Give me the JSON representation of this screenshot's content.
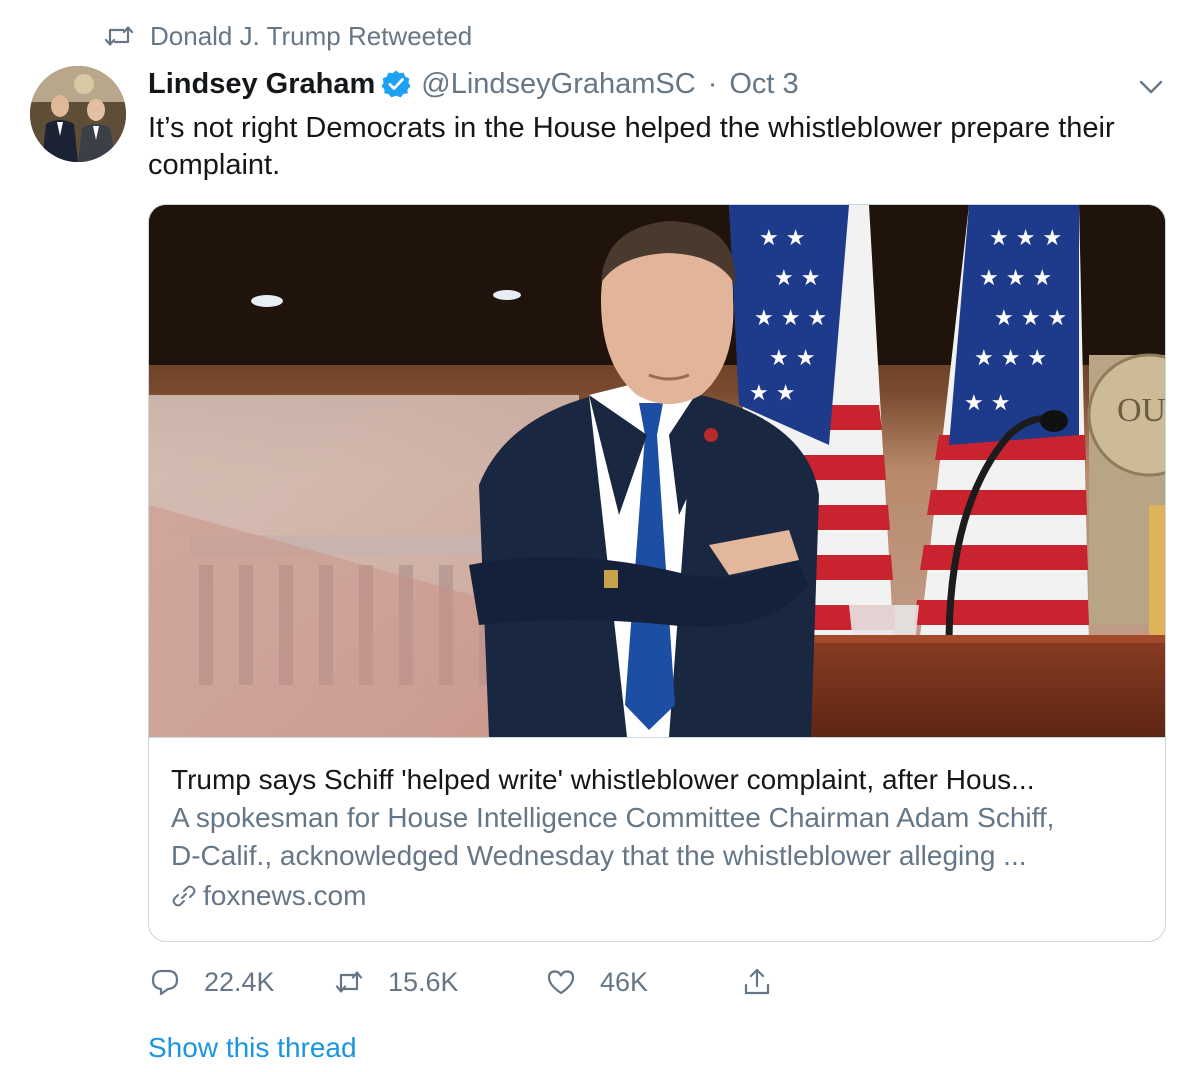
{
  "retweet_banner": {
    "text": "Donald J. Trump Retweeted",
    "icon": "retweet-icon"
  },
  "author": {
    "display_name": "Lindsey Graham",
    "verified": true,
    "handle": "@LindseyGrahamSC",
    "separator": "·",
    "date": "Oct 3"
  },
  "tweet": {
    "text": "It’s not right Democrats in the House helped the whistleblower prepare their complaint."
  },
  "card": {
    "title": "Trump says Schiff 'helped write' whistleblower complaint, after Hous...",
    "description_line1": "A spokesman for House Intelligence Committee Chairman Adam Schiff,",
    "description_line2": "D-Calif., acknowledged Wednesday that the whistleblower alleging ...",
    "domain": "foxnews.com",
    "image_sign_text": "OU"
  },
  "actions": {
    "replies": "22.4K",
    "retweets": "15.6K",
    "likes": "46K"
  },
  "show_thread": "Show this thread",
  "colors": {
    "link_blue": "#1b95e0",
    "verified_blue": "#1da1f2",
    "secondary_text": "#657786",
    "border": "#ccd6dd"
  }
}
